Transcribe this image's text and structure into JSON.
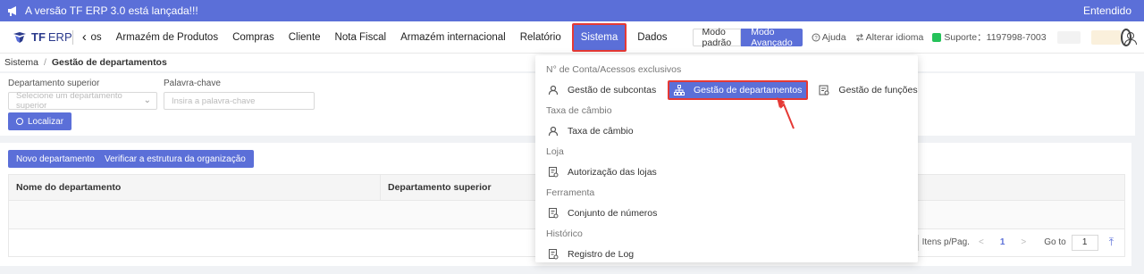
{
  "banner": {
    "text": "A versão TF ERP 3.0 está lançada!!!",
    "dismiss": "Entendido"
  },
  "logo": {
    "brand": "TF",
    "product": "ERP"
  },
  "nav": {
    "items": [
      {
        "label": "os",
        "state": "partial"
      },
      {
        "label": "Armazém de Produtos",
        "state": ""
      },
      {
        "label": "Compras",
        "state": ""
      },
      {
        "label": "Cliente",
        "state": ""
      },
      {
        "label": "Nota Fiscal",
        "state": ""
      },
      {
        "label": "Armazém internacional",
        "state": ""
      },
      {
        "label": "Relatório",
        "state": ""
      },
      {
        "label": "Sistema",
        "state": "active"
      },
      {
        "label": "Dados",
        "state": ""
      }
    ]
  },
  "modes": {
    "standard": "Modo padrão",
    "advanced": "Modo Avançado"
  },
  "tools": {
    "help": "Ajuda",
    "language": "Alterar idioma",
    "support": "Suporte：1197998-7003"
  },
  "breadcrumb": {
    "root": "Sistema",
    "current": "Gestão de departamentos"
  },
  "filters": {
    "parent_label": "Departamento superior",
    "parent_placeholder": "Selecione um departamento superior",
    "keyword_label": "Palavra-chave",
    "keyword_placeholder": "Insira a palavra-chave",
    "search_button": "Localizar"
  },
  "actions": {
    "new_dept": "Novo departamento",
    "verify_structure": "Verificar a estrutura da organização"
  },
  "table": {
    "columns": [
      "Nome do departamento",
      "Departamento superior"
    ]
  },
  "pager": {
    "per_page_label": "Itens p/Pag.",
    "prev": "<",
    "page": "1",
    "next": ">",
    "goto_label": "Go to",
    "goto_value": "1"
  },
  "menu": {
    "sections": [
      {
        "title": "N° de Conta/Acessos exclusivos",
        "items": [
          "Gestão de subcontas",
          "Gestão de departamentos",
          "Gestão de funções"
        ]
      },
      {
        "title": "Taxa de câmbio",
        "items": [
          "Taxa de câmbio"
        ]
      },
      {
        "title": "Loja",
        "items": [
          "Autorização das lojas"
        ]
      },
      {
        "title": "Ferramenta",
        "items": [
          "Conjunto de números"
        ]
      },
      {
        "title": "Histórico",
        "items": [
          "Registro de Log"
        ]
      }
    ]
  },
  "colors": {
    "primary": "#5b6fd8",
    "highlight_border": "#e53935"
  }
}
